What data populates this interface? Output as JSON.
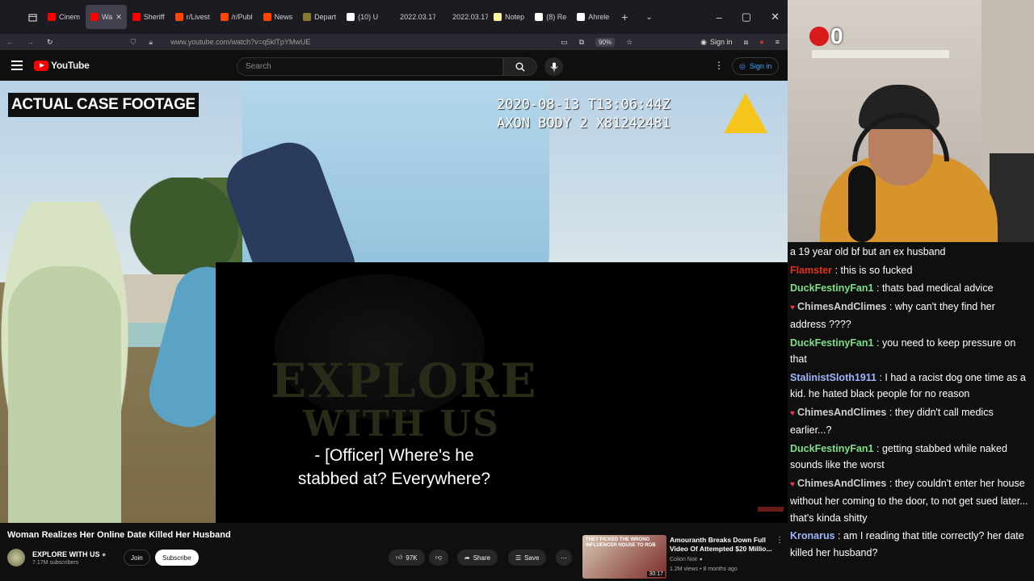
{
  "browser": {
    "tabs": [
      {
        "label": "Cinem",
        "color": "#ff0000",
        "active": false
      },
      {
        "label": "Wa",
        "color": "#ff0000",
        "active": true
      },
      {
        "label": "Sheriff",
        "color": "#ff0000",
        "active": false
      },
      {
        "label": "r/Livest",
        "color": "#ff4500",
        "active": false
      },
      {
        "label": "/r/Publ",
        "color": "#ff4500",
        "active": false
      },
      {
        "label": "News",
        "color": "#ff4500",
        "active": false
      },
      {
        "label": "Depart",
        "color": "#8a7a30",
        "active": false
      },
      {
        "label": "(10) U",
        "color": "#ffffff",
        "active": false
      },
      {
        "label": "2022.03.17",
        "color": "#1c1b22",
        "active": false
      },
      {
        "label": "2022.03.17",
        "color": "#1c1b22",
        "active": false
      },
      {
        "label": "Notep",
        "color": "#fff3a0",
        "active": false
      },
      {
        "label": "(8) Re",
        "color": "#ffffff",
        "active": false
      },
      {
        "label": "Ahrele",
        "color": "#ffffff",
        "active": false
      }
    ],
    "new_tab": "+",
    "url": "www.youtube.com/watch?v=q5klTpYMwUE",
    "zoom": "90%",
    "sign_in": "Sign in"
  },
  "youtube": {
    "logo_text": "YouTube",
    "search_placeholder": "Search",
    "sign_in": "Sign in"
  },
  "video": {
    "badge": "ACTUAL CASE FOOTAGE",
    "timestamp_line1": "2020-08-13 T13:06:44Z",
    "timestamp_line2": "AXON BODY 2 X81242481",
    "watermark_line1": "EXPLORE",
    "watermark_line2": "WITH US",
    "subtitle_line1": "- [Officer] Where's he",
    "subtitle_line2": "stabbed at? Everywhere?"
  },
  "below": {
    "title": "Woman Realizes Her Online Date Killed Her Husband",
    "channel": "EXPLORE WITH US",
    "subs": "7.17M subscribers",
    "join": "Join",
    "subscribe": "Subscribe",
    "likes": "97K",
    "share": "Share",
    "save": "Save",
    "rec": {
      "thumb_text": "THEY PICKED THE WRONG INFLUENCER HOUSE TO ROB",
      "duration": "30:17",
      "title": "Amouranth Breaks Down Full Video Of Attempted $20 Millio...",
      "channel": "Colion Noir",
      "meta": "1.2M views • 8 months ago"
    }
  },
  "stream": {
    "counter": "0"
  },
  "chat": [
    {
      "name": "",
      "color": "#ffffff",
      "heart": false,
      "text": "a 19 year old bf but an ex husband"
    },
    {
      "name": "Flamster",
      "color": "#e0301e",
      "heart": false,
      "text": "this is so fucked"
    },
    {
      "name": "DuckFestinyFan1",
      "color": "#7fe08a",
      "heart": false,
      "text": "thats bad medical advice"
    },
    {
      "name": "ChimesAndClimes",
      "color": "#cfcfcf",
      "heart": true,
      "text": "why can't they find her address ????"
    },
    {
      "name": "DuckFestinyFan1",
      "color": "#7fe08a",
      "heart": false,
      "text": "you need to keep pressure on that"
    },
    {
      "name": "StalinistSloth1911",
      "color": "#9fb6ff",
      "heart": false,
      "text": "I had a racist dog one time as a kid. he hated black people for no reason"
    },
    {
      "name": "ChimesAndClimes",
      "color": "#cfcfcf",
      "heart": true,
      "text": "they didn't call medics earlier...?"
    },
    {
      "name": "DuckFestinyFan1",
      "color": "#7fe08a",
      "heart": false,
      "text": "getting stabbed while naked sounds like the worst"
    },
    {
      "name": "ChimesAndClimes",
      "color": "#cfcfcf",
      "heart": true,
      "text": "they couldn't enter her house without her coming to the door, to not get sued later... that's kinda shitty"
    },
    {
      "name": "Kronarus",
      "color": "#9fb6ff",
      "heart": false,
      "text": "am I reading that title correctly? her date killed her husband?"
    }
  ]
}
